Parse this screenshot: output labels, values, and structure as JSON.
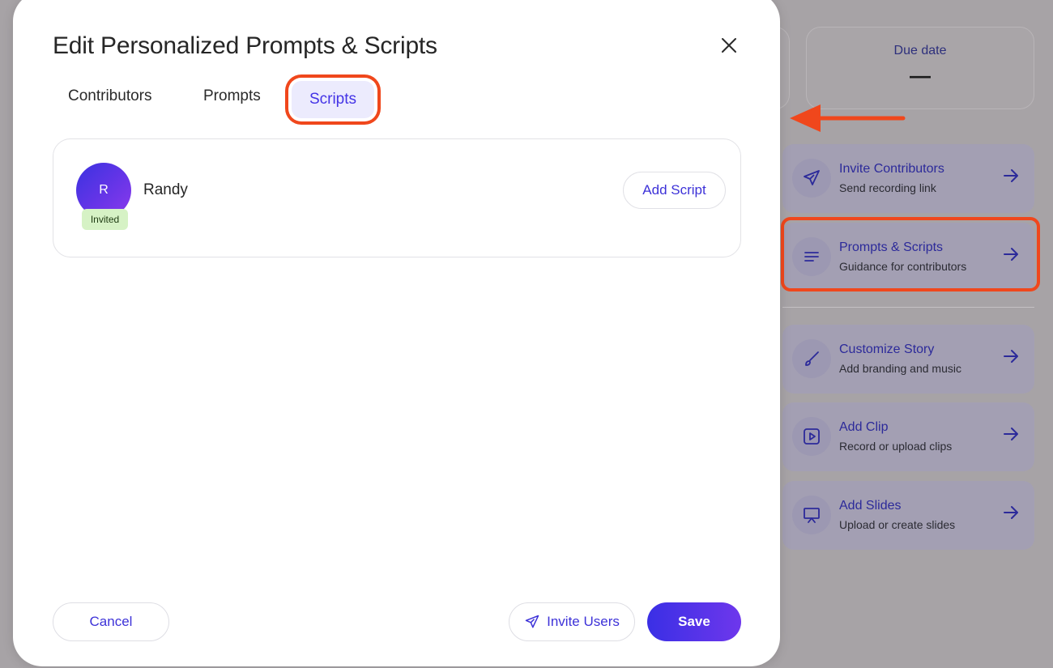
{
  "modal": {
    "title": "Edit Personalized Prompts & Scripts",
    "tabs": [
      {
        "label": "Contributors",
        "active": false
      },
      {
        "label": "Prompts",
        "active": false
      },
      {
        "label": "Scripts",
        "active": true
      }
    ],
    "contributors": [
      {
        "initial": "R",
        "name": "Randy",
        "status": "Invited",
        "action_label": "Add Script"
      }
    ],
    "footer": {
      "cancel_label": "Cancel",
      "invite_label": "Invite Users",
      "save_label": "Save"
    }
  },
  "background": {
    "due_date": {
      "label": "Due date",
      "value": "—"
    },
    "actions": [
      {
        "title": "Invite Contributors",
        "subtitle": "Send recording link",
        "icon": "send-icon"
      },
      {
        "title": "Prompts & Scripts",
        "subtitle": "Guidance for contributors",
        "icon": "lines-icon"
      },
      {
        "title": "Customize Story",
        "subtitle": "Add branding and music",
        "icon": "brush-icon"
      },
      {
        "title": "Add Clip",
        "subtitle": "Record or upload clips",
        "icon": "play-square-icon"
      },
      {
        "title": "Add Slides",
        "subtitle": "Upload or create slides",
        "icon": "presentation-icon"
      }
    ]
  },
  "colors": {
    "accent": "#4434e6",
    "annotation": "#f0471c",
    "invited_badge_bg": "#d6f2c5"
  }
}
